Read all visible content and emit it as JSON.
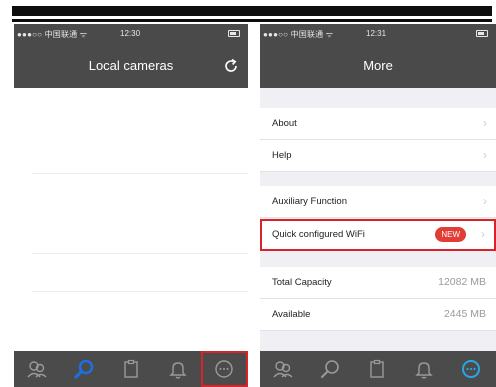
{
  "left_screen": {
    "status": {
      "carrier": "●●●○○ 中国联通 ᯤ",
      "time": "12:30"
    },
    "title": "Local cameras"
  },
  "right_screen": {
    "status": {
      "carrier": "●●●○○ 中国联通 ᯤ",
      "time": "12:31"
    },
    "title": "More",
    "items": {
      "about": "About",
      "help": "Help",
      "auxiliary": "Auxiliary Function",
      "quick_wifi": "Quick configured WiFi",
      "new_badge": "NEW",
      "total_capacity_label": "Total Capacity",
      "total_capacity_value": "12082 MB",
      "available_label": "Available",
      "available_value": "2445 MB"
    }
  },
  "tabbar": {
    "tabs": [
      "devices-icon",
      "search-icon",
      "clipboard-icon",
      "bell-icon",
      "more-icon"
    ],
    "colors": {
      "active_left": "#1e6ee0",
      "active_right": "#2aa6e6",
      "inactive": "#9a9a9a",
      "highlight": "#d8232a"
    }
  }
}
